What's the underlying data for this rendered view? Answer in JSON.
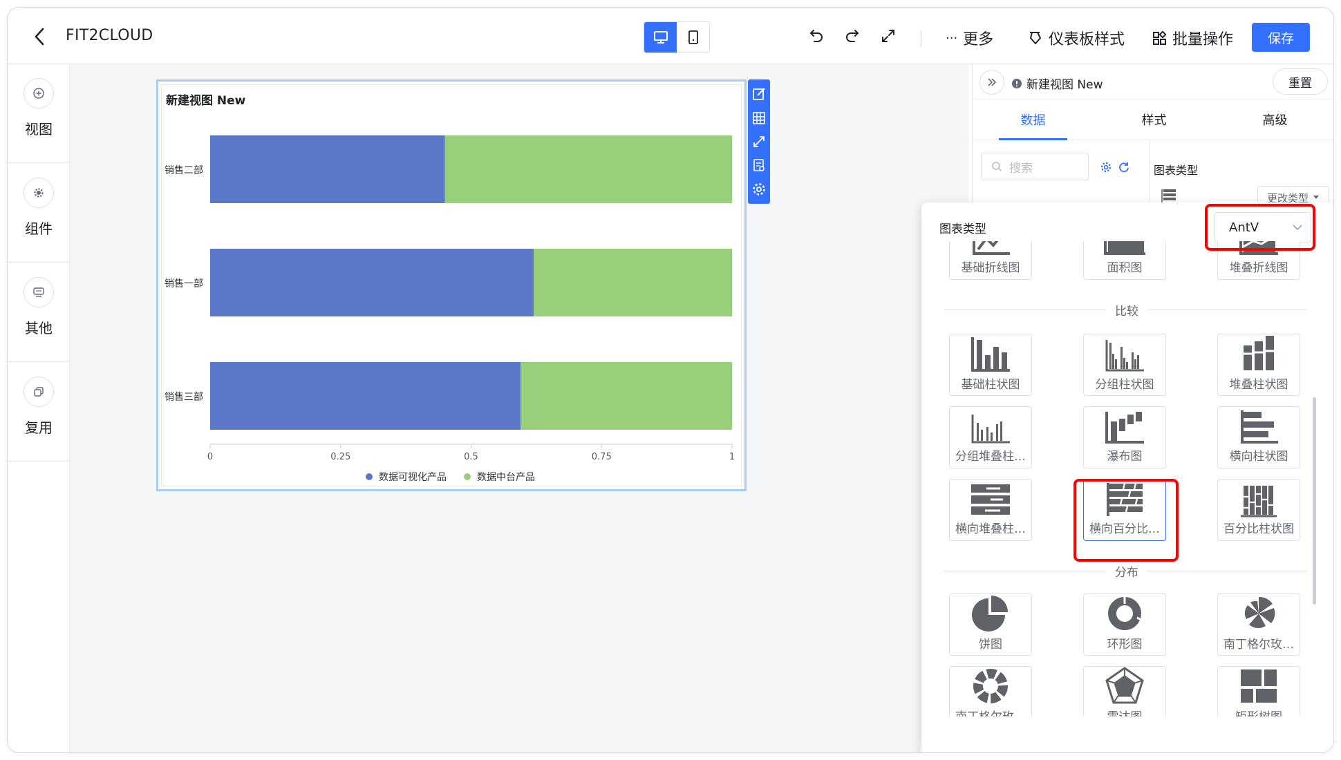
{
  "header": {
    "app_title": "FIT2CLOUD",
    "more_label": "更多",
    "dashboard_style_label": "仪表板样式",
    "batch_label": "批量操作",
    "save_label": "保存"
  },
  "left_rail": [
    {
      "label": "视图",
      "icon": "plus-circle-icon"
    },
    {
      "label": "组件",
      "icon": "gear-icon"
    },
    {
      "label": "其他",
      "icon": "media-icon"
    },
    {
      "label": "复用",
      "icon": "copy-icon"
    }
  ],
  "chart_card": {
    "title": "新建视图 New"
  },
  "chart_data": {
    "type": "bar",
    "orientation": "horizontal",
    "stacking": "percent",
    "categories": [
      "销售二部",
      "销售一部",
      "销售三部"
    ],
    "series": [
      {
        "name": "数据可视化产品",
        "values": [
          0.45,
          0.62,
          0.595
        ],
        "color": "#5b78c8"
      },
      {
        "name": "数据中台产品",
        "values": [
          0.55,
          0.38,
          0.405
        ],
        "color": "#97cf7b"
      }
    ],
    "xlim": [
      0,
      1
    ],
    "xticks": [
      "0",
      "0.25",
      "0.5",
      "0.75",
      "1"
    ],
    "legend_position": "bottom"
  },
  "right_panel": {
    "view_name": "新建视图 New",
    "reset_label": "重置",
    "tabs": [
      "数据",
      "样式",
      "高级"
    ],
    "active_tab": "数据",
    "search_placeholder": "搜索",
    "chart_type_label": "图表类型",
    "change_type_label": "更改类型"
  },
  "popup": {
    "title": "图表类型",
    "library": "AntV",
    "top_row": [
      "基础折线图",
      "面积图",
      "堆叠折线图"
    ],
    "sections": [
      {
        "title": "比较",
        "items": [
          "基础柱状图",
          "分组柱状图",
          "堆叠柱状图",
          "分组堆叠柱…",
          "瀑布图",
          "横向柱状图",
          "横向堆叠柱…",
          "横向百分比…",
          "百分比柱状图"
        ]
      },
      {
        "title": "分布",
        "items": [
          "饼图",
          "环形图",
          "南丁格尔玫…",
          "南丁格尔玫…",
          "雷达图",
          "矩形树图"
        ]
      }
    ],
    "selected_item": "横向百分比…"
  },
  "colors": {
    "accent": "#3370ff",
    "highlight_box": "#ff0000",
    "icon_gray": "#5f6368"
  }
}
